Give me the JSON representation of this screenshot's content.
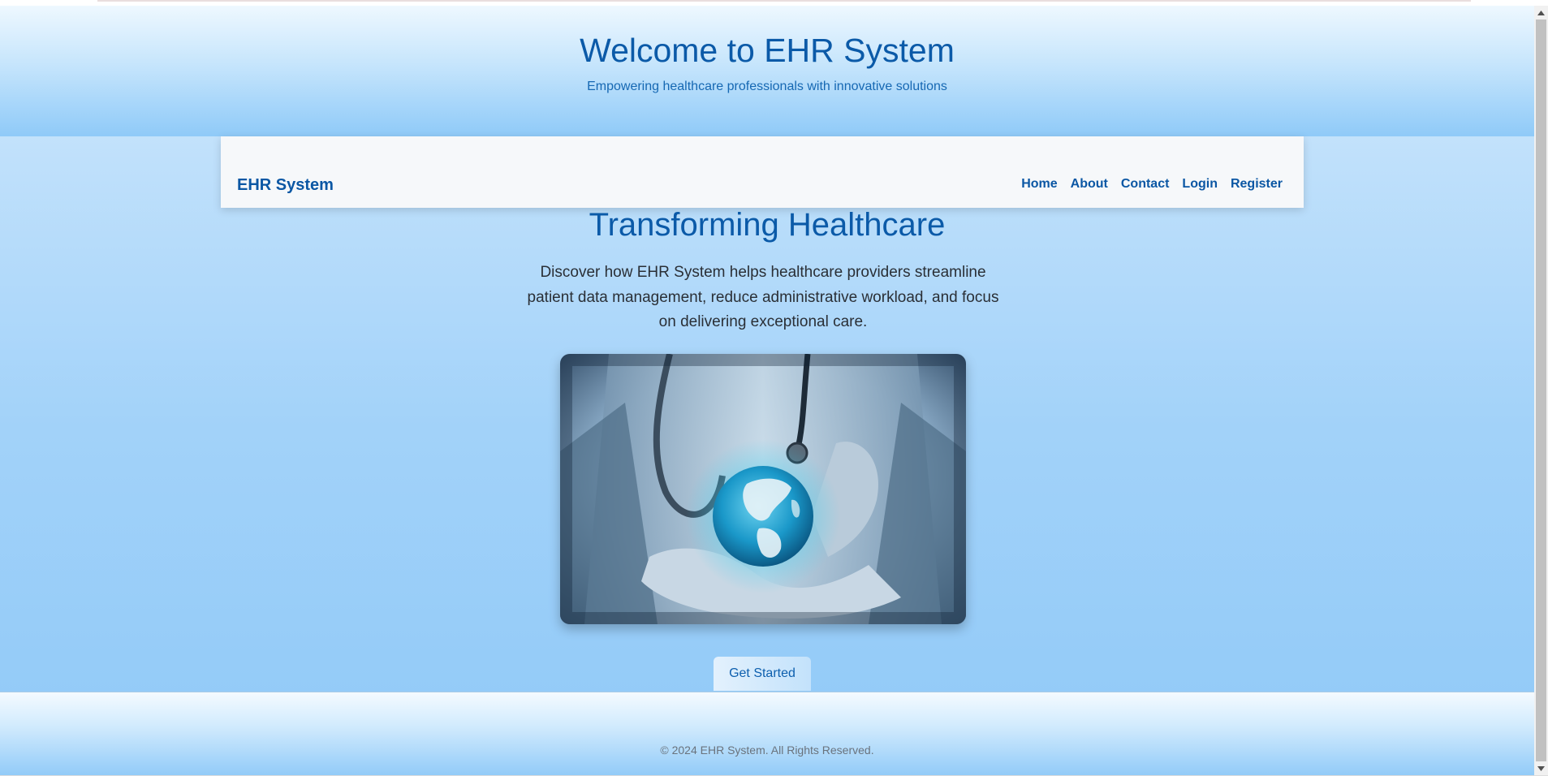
{
  "header": {
    "title": "Welcome to EHR System",
    "subtitle": "Empowering healthcare professionals with innovative solutions"
  },
  "navbar": {
    "brand": "EHR System",
    "links": [
      {
        "label": "Home"
      },
      {
        "label": "About"
      },
      {
        "label": "Contact"
      },
      {
        "label": "Login"
      },
      {
        "label": "Register"
      }
    ]
  },
  "hero": {
    "title": "Transforming Healthcare",
    "description": "Discover how EHR System helps healthcare providers streamline patient data management, reduce administrative workload, and focus on delivering exceptional care.",
    "image_alt": "Doctor holding a glowing globe",
    "cta_label": "Get Started"
  },
  "footer": {
    "copyright": "© 2024 EHR System. All Rights Reserved."
  },
  "colors": {
    "primary": "#0b5aa8",
    "nav_background": "#f6f8fa",
    "page_gradient_bottom": "#90c9f8"
  }
}
